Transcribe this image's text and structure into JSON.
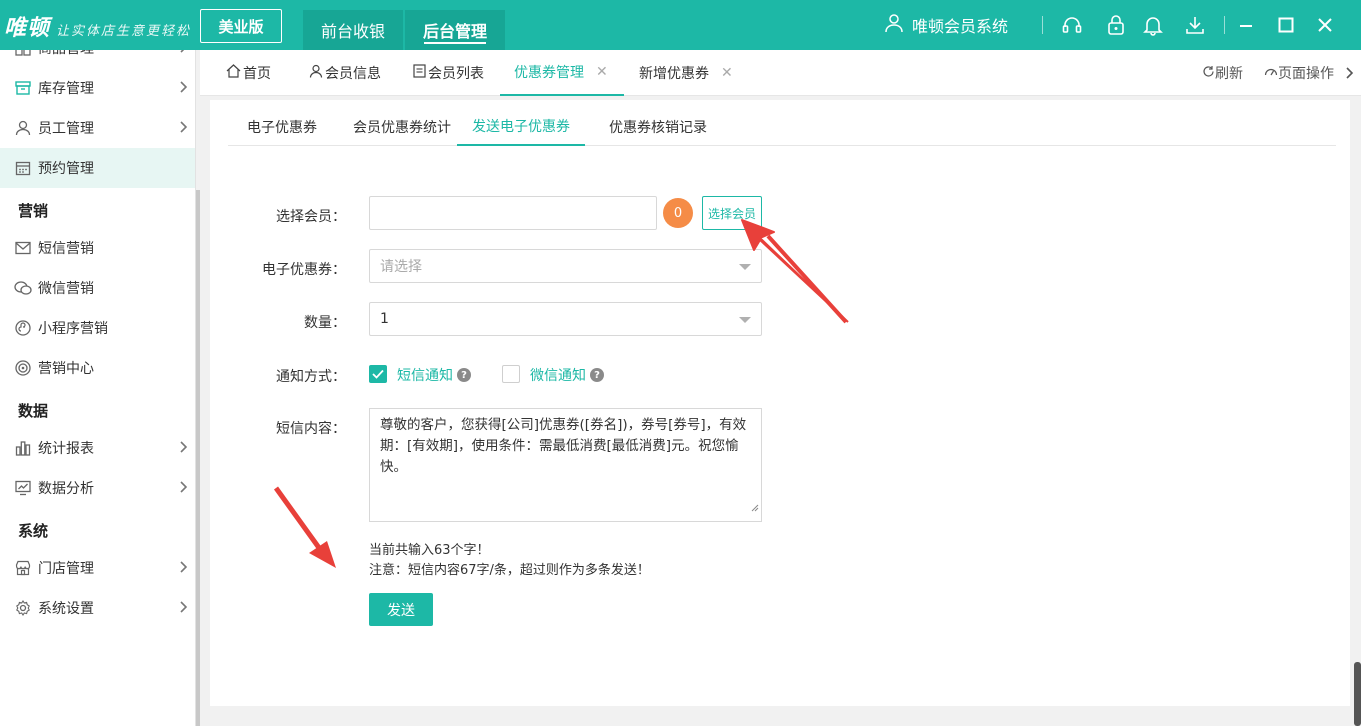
{
  "app": {
    "logo_text": "唯顿",
    "logo_tagline": "让实体店生意更轻松",
    "edition": "美业版",
    "mode_tabs": [
      "前台收银",
      "后台管理"
    ],
    "system_name": "唯顿会员系统"
  },
  "sidebar": {
    "items": [
      {
        "label": "商品管理"
      },
      {
        "label": "库存管理"
      },
      {
        "label": "员工管理"
      },
      {
        "label": "预约管理"
      },
      {
        "label": "短信营销"
      },
      {
        "label": "微信营销"
      },
      {
        "label": "小程序营销"
      },
      {
        "label": "营销中心"
      },
      {
        "label": "统计报表"
      },
      {
        "label": "数据分析"
      },
      {
        "label": "门店管理"
      },
      {
        "label": "系统设置"
      }
    ],
    "groups": [
      "营销",
      "数据",
      "系统"
    ]
  },
  "page_tabs": {
    "tabs": [
      "首页",
      "会员信息",
      "会员列表",
      "优惠券管理",
      "新增优惠券"
    ],
    "refresh": "刷新",
    "page_ops": "页面操作"
  },
  "sub_tabs": [
    "电子优惠券",
    "会员优惠券统计",
    "发送电子优惠券",
    "优惠券核销记录"
  ],
  "form": {
    "member_label": "选择会员：",
    "member_value": "",
    "member_count": "0",
    "choose_member_btn": "选择会员",
    "coupon_label": "电子优惠券：",
    "coupon_placeholder": "请选择",
    "qty_label": "数量：",
    "qty_value": "1",
    "notify_label": "通知方式：",
    "notify_sms": "短信通知",
    "notify_wechat": "微信通知",
    "sms_label": "短信内容：",
    "sms_content": "尊敬的客户，您获得[公司]优惠券([券名])，券号[券号]，有效期：[有效期]，使用条件：需最低消费[最低消费]元。祝您愉快。",
    "hint_count": "当前共输入63个字！",
    "hint_note": "注意：短信内容67字/条，超过则作为多条发送！",
    "send_btn": "发送"
  },
  "colors": {
    "brand": "#1db8a6",
    "badge": "#f58c47",
    "arrow": "#e8403a"
  }
}
